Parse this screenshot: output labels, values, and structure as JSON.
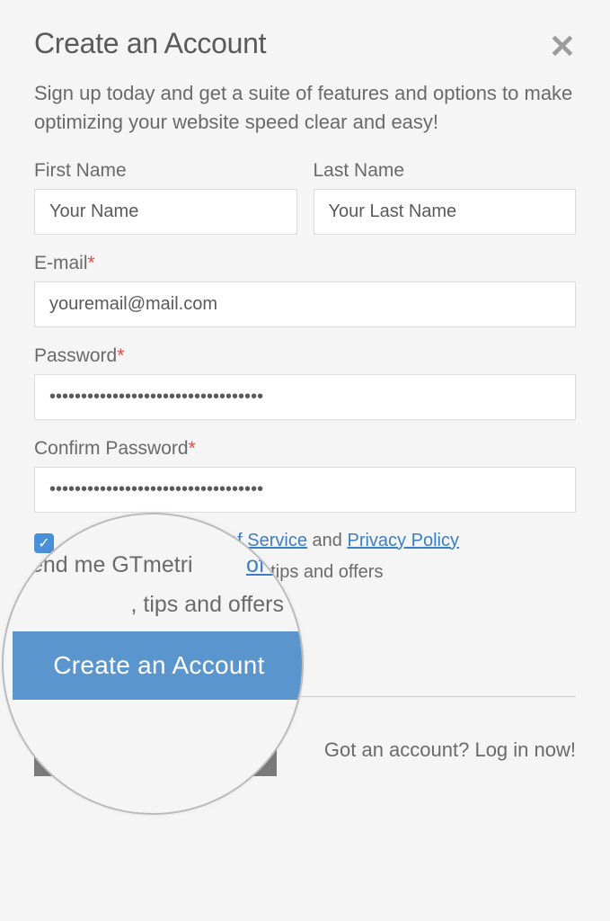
{
  "modal": {
    "title": "Create an Account",
    "subtitle": "Sign up today and get a suite of features and options to make optimizing your website speed clear and easy!"
  },
  "form": {
    "firstName": {
      "label": "First Name",
      "value": "Your Name"
    },
    "lastName": {
      "label": "Last Name",
      "value": "Your Last Name"
    },
    "email": {
      "label": "E-mail",
      "value": "youremail@mail.com"
    },
    "password": {
      "label": "Password",
      "value": "••••••••••••••••••••••••••••••••••"
    },
    "confirmPassword": {
      "label": "Confirm Password",
      "value": "••••••••••••••••••••••••••••••••••"
    }
  },
  "terms": {
    "tosLink": "of Service",
    "andText": " and ",
    "privacyLink": "Privacy Policy",
    "newsletterSnippet": ", tips and offers"
  },
  "magnifier": {
    "line1": "end me GTmetri",
    "button": "Create an Account"
  },
  "footer": {
    "loginText": "Got an account? Log in now!"
  },
  "asterisk": "*"
}
